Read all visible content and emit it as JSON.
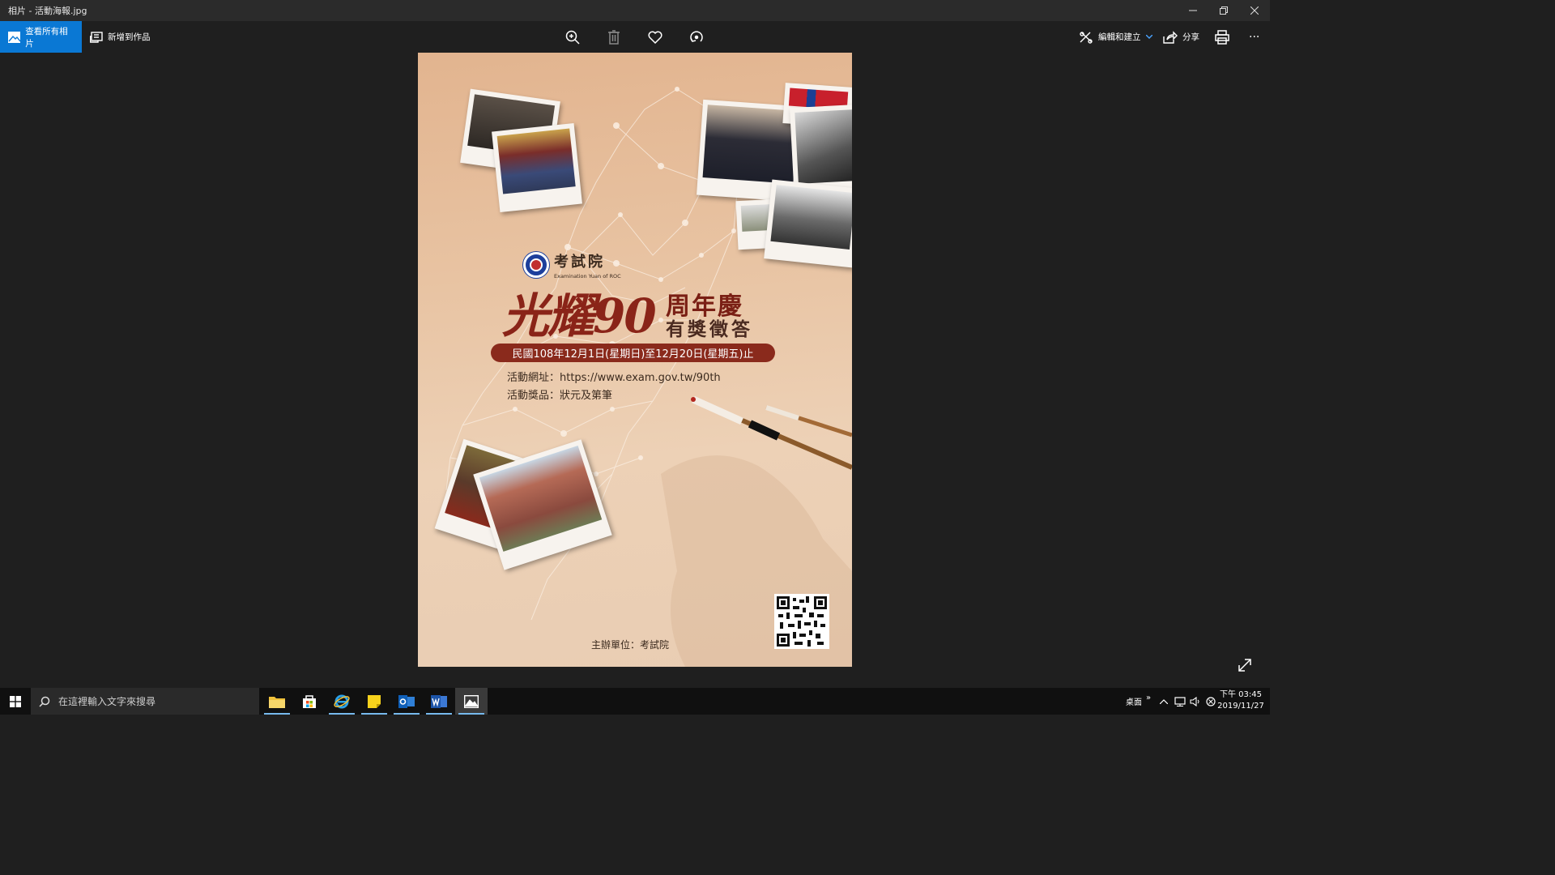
{
  "window": {
    "title": "相片 - 活動海報.jpg"
  },
  "toolbar": {
    "view_all_label": "查看所有相片",
    "add_to_creation_label": "新增到作品",
    "edit_create_label": "編輯和建立",
    "share_label": "分享",
    "more_label": "···"
  },
  "poster": {
    "org_name_zh": "考試院",
    "org_name_en": "Examination Yuan of ROC",
    "headline_main": "光耀90",
    "headline_side1": "周年慶",
    "headline_side2": "有獎徵答",
    "date_range": "民國108年12月1日(星期日)至12月20日(星期五)止",
    "website": "活動網址：https://www.exam.gov.tw/90th",
    "prize": "活動獎品：狀元及第筆",
    "organizer": "主辦單位：考試院"
  },
  "taskbar": {
    "search_placeholder": "在這裡輸入文字來搜尋",
    "desktop_label": "桌面",
    "chevron_label": "»",
    "time": "下午 03:45",
    "date": "2019/11/27"
  },
  "colors": {
    "accent": "#0a78d4",
    "poster_red": "#8a2418",
    "poster_bg": "#e8c3a2"
  }
}
